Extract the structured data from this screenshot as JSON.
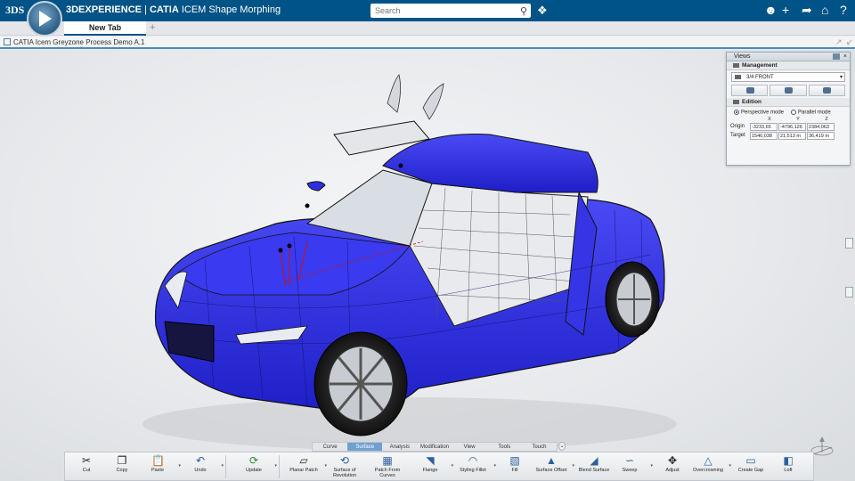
{
  "topbar": {
    "logo": "3DS",
    "brand": "3DEXPERIENCE",
    "separator": "|",
    "app_brand": "CATIA",
    "app_name": "ICEM Shape Morphing",
    "search_placeholder": "Search",
    "icons": [
      "tag-icon",
      "user-icon",
      "add-icon",
      "share-icon",
      "home-icon",
      "help-icon"
    ]
  },
  "tabs": {
    "items": [
      {
        "label": "New Tab"
      }
    ],
    "add_label": "+"
  },
  "document": {
    "title": "CATIA Icem Greyzone Process Demo A.1"
  },
  "views_panel": {
    "title": "Views",
    "management_label": "Management",
    "selected_view": "3/4 FRONT",
    "edition_label": "Edition",
    "perspective_label": "Perspective mode",
    "parallel_label": "Parallel mode",
    "mode_selected": "perspective",
    "axes": [
      "X",
      "Y",
      "Z"
    ],
    "origin_label": "Origin",
    "origin": [
      "-3233,65",
      "-4796,126",
      "2384,063"
    ],
    "target_label": "Target",
    "target": [
      "1546,038",
      "21,513 m",
      "36,419 m"
    ]
  },
  "section_tabs": [
    "Curve",
    "Surface",
    "Analysis",
    "Modification",
    "View",
    "Tools",
    "Touch"
  ],
  "active_section_tab": "Surface",
  "toolbar": {
    "cut": "Cut",
    "copy": "Copy",
    "paste": "Paste",
    "undo": "Undo",
    "update": "Update",
    "planar_patch": "Planar Patch",
    "surface_of_revolution": "Surface of Revolution",
    "patch_from_curves": "Patch From Curves",
    "flange": "Flange",
    "styling_fillet": "Styling Fillet",
    "fill": "Fill",
    "surface_offset": "Surface Offset",
    "blend_surface": "Blend Surface",
    "sweep": "Sweep",
    "adjust": "Adjust",
    "overcrowning": "Overcrowning",
    "create_gap": "Create Gap",
    "loft": "Loft"
  },
  "colors": {
    "topbar": "#005386",
    "car_body": "#2e2ee0",
    "accent": "#6fa0d2"
  }
}
